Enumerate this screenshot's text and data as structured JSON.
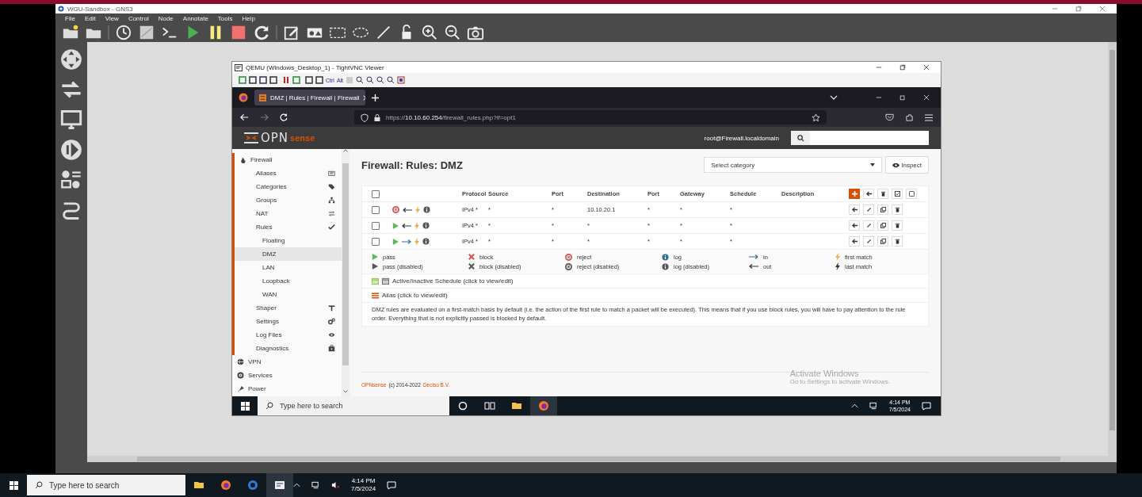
{
  "gns3": {
    "title": "WGU-Sandbox - GNS3",
    "menu": [
      "File",
      "Edit",
      "View",
      "Control",
      "Node",
      "Annotate",
      "Tools",
      "Help"
    ]
  },
  "vnc": {
    "title": "QEMU (Windows_Desktop_1) - TightVNC Viewer",
    "toolbar_keys": [
      "Ctrl",
      "Alt"
    ]
  },
  "browser": {
    "tabs": [
      {
        "title": "DMZ | Rules | Firewall | Firewall",
        "selected": true
      }
    ],
    "url": {
      "scheme": "https://",
      "host": "10.10.60.254",
      "path": "/firewall_rules.php?if=opt1"
    }
  },
  "opnsense": {
    "logo": {
      "left": "OPN",
      "right": "sense"
    },
    "user": "root@Firewall.localdomain"
  },
  "sidebar": [
    {
      "label": "Firewall",
      "selected": false,
      "expanded": true,
      "children": [
        {
          "label": "Aliases",
          "selected": false
        },
        {
          "label": "Categories",
          "selected": false
        },
        {
          "label": "Groups",
          "selected": false
        },
        {
          "label": "NAT",
          "selected": false
        },
        {
          "label": "Rules",
          "selected": false,
          "expanded": true,
          "children": [
            {
              "label": "Floating",
              "selected": false
            },
            {
              "label": "DMZ",
              "selected": true
            },
            {
              "label": "LAN",
              "selected": false
            },
            {
              "label": "Loopback",
              "selected": false
            },
            {
              "label": "WAN",
              "selected": false
            }
          ]
        },
        {
          "label": "Shaper",
          "selected": false
        },
        {
          "label": "Settings",
          "selected": false
        },
        {
          "label": "Log Files",
          "selected": false
        },
        {
          "label": "Diagnostics",
          "selected": false
        }
      ]
    },
    {
      "label": "VPN",
      "selected": false
    },
    {
      "label": "Services",
      "selected": false
    },
    {
      "label": "Power",
      "selected": false
    }
  ],
  "page": {
    "title": "Firewall: Rules: DMZ",
    "category_select": "Select category",
    "inspect_button": "Inspect"
  },
  "rules_table": {
    "all_checked": false,
    "columns": [
      "Protocol",
      "Source",
      "Port",
      "Destination",
      "Port",
      "Gateway",
      "Schedule",
      "Description"
    ],
    "rows": [
      {
        "checked": false,
        "icons": [
          {
            "kind": "rule_reject"
          },
          {
            "kind": "dir_out"
          },
          {
            "kind": "match_first"
          },
          {
            "kind": "rule_log",
            "disabled": true
          }
        ],
        "cells": [
          "IPv4 *",
          "*",
          "*",
          "10.10.20.1",
          "*",
          "*",
          "*"
        ]
      },
      {
        "checked": false,
        "icons": [
          {
            "kind": "rule_pass"
          },
          {
            "kind": "dir_out"
          },
          {
            "kind": "match_first"
          },
          {
            "kind": "rule_log",
            "disabled": true
          }
        ],
        "cells": [
          "IPv4 *",
          "*",
          "*",
          "*",
          "*",
          "*",
          "*"
        ]
      },
      {
        "checked": false,
        "icons": [
          {
            "kind": "rule_pass"
          },
          {
            "kind": "dir_in"
          },
          {
            "kind": "match_first"
          },
          {
            "kind": "rule_log",
            "disabled": true
          }
        ],
        "cells": [
          "IPv4 *",
          "*",
          "*",
          "*",
          "*",
          "*",
          "*"
        ]
      }
    ]
  },
  "legend": [
    {
      "kind": "rule_pass",
      "disabled": false,
      "label": "pass"
    },
    {
      "kind": "rule_block",
      "disabled": false,
      "label": "block"
    },
    {
      "kind": "rule_reject",
      "disabled": false,
      "label": "reject"
    },
    {
      "kind": "rule_log",
      "disabled": false,
      "label": "log"
    },
    {
      "kind": "dir_in",
      "label": "in"
    },
    {
      "kind": "match_first",
      "label": "first match"
    },
    {
      "kind": "rule_pass",
      "disabled": true,
      "label": "pass (disabled)"
    },
    {
      "kind": "rule_block",
      "disabled": true,
      "label": "block (disabled)"
    },
    {
      "kind": "rule_reject",
      "disabled": true,
      "label": "reject (disabled)"
    },
    {
      "kind": "rule_log",
      "disabled": true,
      "label": "log (disabled)"
    },
    {
      "kind": "dir_out",
      "label": "out"
    },
    {
      "kind": "match_last",
      "label": "last match"
    }
  ],
  "schedule_note": "Active/Inactive Schedule (click to view/edit)",
  "alias_note": "Alias (click to view/edit)",
  "info": "DMZ rules are evaluated on a first-match basis by default (i.e. the action of the first rule to match a packet will be executed). This means that if you use block rules, you will have to pay attention to the rule order. Everything that is not explicitly passed is blocked by default.",
  "footer": {
    "brand": "OPNsense",
    "copyright": "(c) 2014-2022",
    "company": "Deciso B.V."
  },
  "activation": {
    "title": "Activate Windows",
    "subtitle": "Go to Settings to activate Windows."
  },
  "guest_taskbar": {
    "search_placeholder": "Type here to search",
    "time": "4:14 PM",
    "date": "7/5/2024"
  },
  "host_taskbar": {
    "search_placeholder": "Type here to search",
    "time": "4:14 PM",
    "date": "7/5/2024"
  }
}
